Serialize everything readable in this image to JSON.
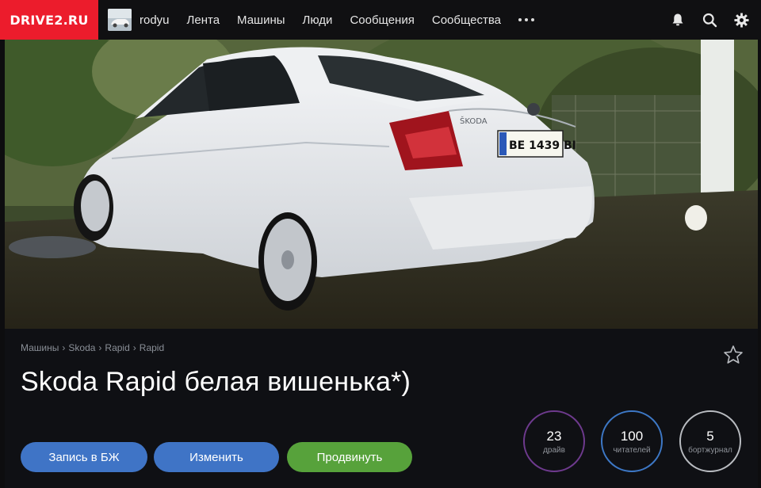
{
  "header": {
    "logo": "DRIVE2.RU",
    "username": "rodyu",
    "nav": [
      "Лента",
      "Машины",
      "Люди",
      "Сообщения",
      "Сообщества"
    ],
    "icons": [
      "bell-icon",
      "search-icon",
      "gear-icon"
    ]
  },
  "hero": {
    "plate": "BE 1439 BI",
    "badge": "ŠKODA"
  },
  "breadcrumb": [
    "Машины",
    "Skoda",
    "Rapid",
    "Rapid"
  ],
  "title": "Skoda Rapid белая вишенька*)",
  "buttons": {
    "logbook": "Запись в БЖ",
    "edit": "Изменить",
    "promote": "Продвинуть"
  },
  "stats": [
    {
      "value": "23",
      "label": "драйв"
    },
    {
      "value": "100",
      "label": "читателей"
    },
    {
      "value": "5",
      "label": "бортжурнал"
    }
  ],
  "colors": {
    "logo_bg": "#ec1c2c",
    "button_blue": "#3f74c6",
    "button_green": "#57a23b",
    "stat_drive": "#6e3a8e",
    "stat_readers": "#3d78c6",
    "stat_journal": "#b9bcc1"
  }
}
